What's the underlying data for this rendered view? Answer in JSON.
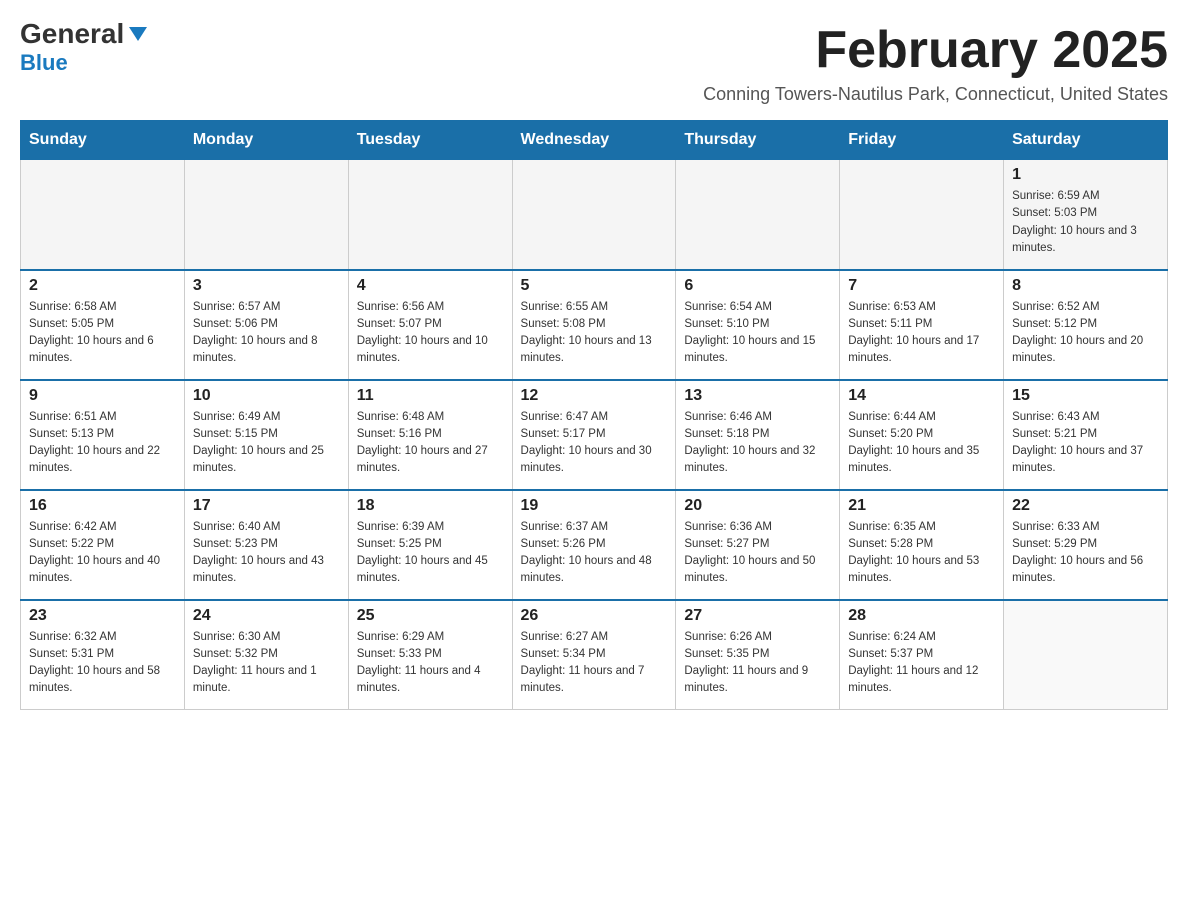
{
  "logo": {
    "name": "General",
    "sub": "Blue"
  },
  "header": {
    "title": "February 2025",
    "subtitle": "Conning Towers-Nautilus Park, Connecticut, United States"
  },
  "days_of_week": [
    "Sunday",
    "Monday",
    "Tuesday",
    "Wednesday",
    "Thursday",
    "Friday",
    "Saturday"
  ],
  "weeks": [
    [
      {
        "day": "",
        "info": ""
      },
      {
        "day": "",
        "info": ""
      },
      {
        "day": "",
        "info": ""
      },
      {
        "day": "",
        "info": ""
      },
      {
        "day": "",
        "info": ""
      },
      {
        "day": "",
        "info": ""
      },
      {
        "day": "1",
        "info": "Sunrise: 6:59 AM\nSunset: 5:03 PM\nDaylight: 10 hours and 3 minutes."
      }
    ],
    [
      {
        "day": "2",
        "info": "Sunrise: 6:58 AM\nSunset: 5:05 PM\nDaylight: 10 hours and 6 minutes."
      },
      {
        "day": "3",
        "info": "Sunrise: 6:57 AM\nSunset: 5:06 PM\nDaylight: 10 hours and 8 minutes."
      },
      {
        "day": "4",
        "info": "Sunrise: 6:56 AM\nSunset: 5:07 PM\nDaylight: 10 hours and 10 minutes."
      },
      {
        "day": "5",
        "info": "Sunrise: 6:55 AM\nSunset: 5:08 PM\nDaylight: 10 hours and 13 minutes."
      },
      {
        "day": "6",
        "info": "Sunrise: 6:54 AM\nSunset: 5:10 PM\nDaylight: 10 hours and 15 minutes."
      },
      {
        "day": "7",
        "info": "Sunrise: 6:53 AM\nSunset: 5:11 PM\nDaylight: 10 hours and 17 minutes."
      },
      {
        "day": "8",
        "info": "Sunrise: 6:52 AM\nSunset: 5:12 PM\nDaylight: 10 hours and 20 minutes."
      }
    ],
    [
      {
        "day": "9",
        "info": "Sunrise: 6:51 AM\nSunset: 5:13 PM\nDaylight: 10 hours and 22 minutes."
      },
      {
        "day": "10",
        "info": "Sunrise: 6:49 AM\nSunset: 5:15 PM\nDaylight: 10 hours and 25 minutes."
      },
      {
        "day": "11",
        "info": "Sunrise: 6:48 AM\nSunset: 5:16 PM\nDaylight: 10 hours and 27 minutes."
      },
      {
        "day": "12",
        "info": "Sunrise: 6:47 AM\nSunset: 5:17 PM\nDaylight: 10 hours and 30 minutes."
      },
      {
        "day": "13",
        "info": "Sunrise: 6:46 AM\nSunset: 5:18 PM\nDaylight: 10 hours and 32 minutes."
      },
      {
        "day": "14",
        "info": "Sunrise: 6:44 AM\nSunset: 5:20 PM\nDaylight: 10 hours and 35 minutes."
      },
      {
        "day": "15",
        "info": "Sunrise: 6:43 AM\nSunset: 5:21 PM\nDaylight: 10 hours and 37 minutes."
      }
    ],
    [
      {
        "day": "16",
        "info": "Sunrise: 6:42 AM\nSunset: 5:22 PM\nDaylight: 10 hours and 40 minutes."
      },
      {
        "day": "17",
        "info": "Sunrise: 6:40 AM\nSunset: 5:23 PM\nDaylight: 10 hours and 43 minutes."
      },
      {
        "day": "18",
        "info": "Sunrise: 6:39 AM\nSunset: 5:25 PM\nDaylight: 10 hours and 45 minutes."
      },
      {
        "day": "19",
        "info": "Sunrise: 6:37 AM\nSunset: 5:26 PM\nDaylight: 10 hours and 48 minutes."
      },
      {
        "day": "20",
        "info": "Sunrise: 6:36 AM\nSunset: 5:27 PM\nDaylight: 10 hours and 50 minutes."
      },
      {
        "day": "21",
        "info": "Sunrise: 6:35 AM\nSunset: 5:28 PM\nDaylight: 10 hours and 53 minutes."
      },
      {
        "day": "22",
        "info": "Sunrise: 6:33 AM\nSunset: 5:29 PM\nDaylight: 10 hours and 56 minutes."
      }
    ],
    [
      {
        "day": "23",
        "info": "Sunrise: 6:32 AM\nSunset: 5:31 PM\nDaylight: 10 hours and 58 minutes."
      },
      {
        "day": "24",
        "info": "Sunrise: 6:30 AM\nSunset: 5:32 PM\nDaylight: 11 hours and 1 minute."
      },
      {
        "day": "25",
        "info": "Sunrise: 6:29 AM\nSunset: 5:33 PM\nDaylight: 11 hours and 4 minutes."
      },
      {
        "day": "26",
        "info": "Sunrise: 6:27 AM\nSunset: 5:34 PM\nDaylight: 11 hours and 7 minutes."
      },
      {
        "day": "27",
        "info": "Sunrise: 6:26 AM\nSunset: 5:35 PM\nDaylight: 11 hours and 9 minutes."
      },
      {
        "day": "28",
        "info": "Sunrise: 6:24 AM\nSunset: 5:37 PM\nDaylight: 11 hours and 12 minutes."
      },
      {
        "day": "",
        "info": ""
      }
    ]
  ]
}
